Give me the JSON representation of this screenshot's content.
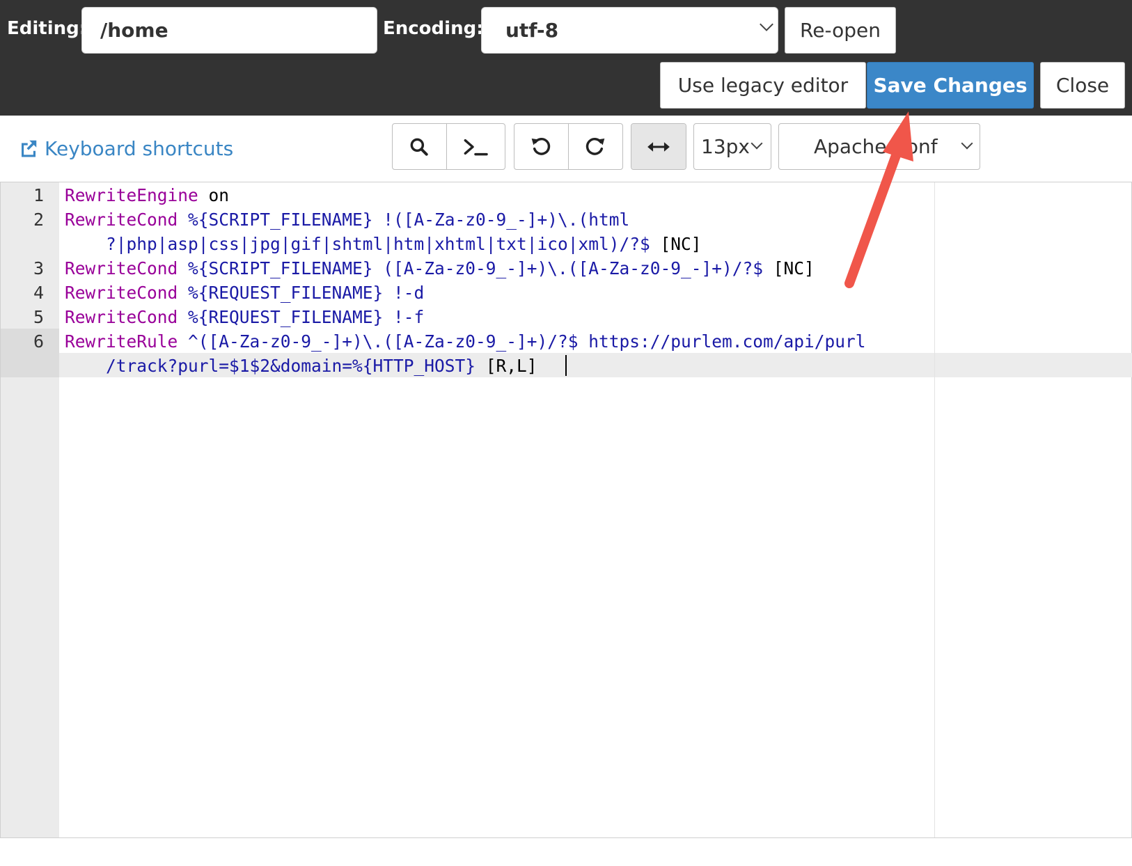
{
  "header": {
    "editing_label": "Editing:",
    "path_value": "/home",
    "encoding_label": "Encoding:",
    "encoding_value": "utf-8",
    "reopen_label": "Re-open",
    "legacy_label": "Use legacy editor",
    "save_label": "Save Changes",
    "close_label": "Close"
  },
  "toolbar": {
    "shortcuts_label": "Keyboard shortcuts",
    "font_size": "13px",
    "mode": "Apache Conf",
    "icons": [
      "search-icon",
      "terminal-icon",
      "undo-icon",
      "redo-icon",
      "wrap-icon"
    ]
  },
  "editor": {
    "line_numbers": [
      "1",
      "2",
      "3",
      "4",
      "5",
      "6"
    ],
    "lines": [
      {
        "kw": "RewriteEngine",
        "rest": " ",
        "plain": "on"
      },
      {
        "kw": "RewriteCond",
        "rest": " %{SCRIPT_FILENAME} !([A-Za-z0-9_-]+)\\.(html",
        "plain": ""
      },
      {
        "kw": "",
        "rest": "    ?|php|asp|css|jpg|gif|shtml|htm|xhtml|txt|ico|xml)/?$",
        "plain": " [NC]"
      },
      {
        "kw": "RewriteCond",
        "rest": " %{SCRIPT_FILENAME} ([A-Za-z0-9_-]+)\\.([A-Za-z0-9_-]+)/?$",
        "plain": " [NC]"
      },
      {
        "kw": "RewriteCond",
        "rest": " %{REQUEST_FILENAME} !-d",
        "plain": ""
      },
      {
        "kw": "RewriteCond",
        "rest": " %{REQUEST_FILENAME} !-f",
        "plain": ""
      },
      {
        "kw": "RewriteRule",
        "rest": " ^([A-Za-z0-9_-]+)\\.([A-Za-z0-9_-]+)/?$ https://purlem.com/api/purl",
        "plain": ""
      },
      {
        "kw": "",
        "rest": "    /track?purl=$1$2&domain=%{HTTP_HOST}",
        "plain": " [R,L]"
      }
    ]
  },
  "colors": {
    "header_bg": "#333333",
    "primary": "#3b87c8",
    "keyword": "#990099",
    "string": "#1a1aa6",
    "arrow": "#f0564a"
  }
}
